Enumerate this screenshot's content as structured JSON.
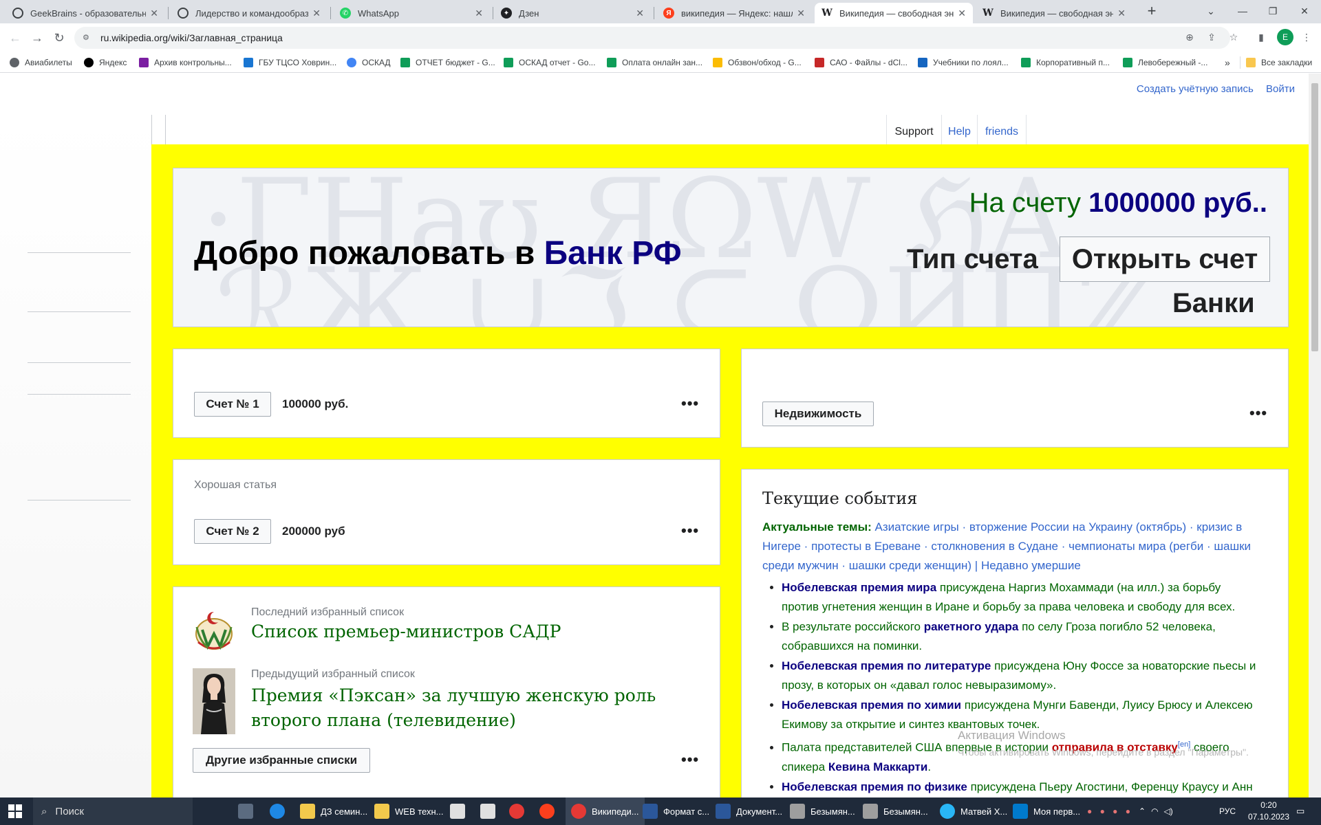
{
  "browser": {
    "tabs": [
      {
        "label": "GeekBrains - образовательный",
        "icon_color": "#3c4043"
      },
      {
        "label": "Лидерство и командообразов",
        "icon_color": "#3c4043"
      },
      {
        "label": "WhatsApp",
        "icon_color": "#25d366"
      },
      {
        "label": "Дзен",
        "icon_color": "#202124"
      },
      {
        "label": "википедия — Яндекс: нашлос",
        "icon_color": "#fc3f1d"
      },
      {
        "label": "Википедия — свободная энц",
        "icon_color": "#202124"
      },
      {
        "label": "Википедия — свободная энц",
        "icon_color": "#202124"
      }
    ],
    "new_tab": "+",
    "url": "ru.wikipedia.org/wiki/Заглавная_страница",
    "profile_initial": "E",
    "bookmarks": [
      {
        "label": "Авиабилеты",
        "color": "#5f6368"
      },
      {
        "label": "Яндекс",
        "color": "#000000"
      },
      {
        "label": "Архив контрольны...",
        "color": "#7b1fa2"
      },
      {
        "label": "ГБУ ТЦСО Ховрин...",
        "color": "#1976d2"
      },
      {
        "label": "ОСКАД",
        "color": "#4285f4"
      },
      {
        "label": "ОТЧЕТ бюджет - G...",
        "color": "#0f9d58"
      },
      {
        "label": "ОСКАД отчет - Go...",
        "color": "#0f9d58"
      },
      {
        "label": "Оплата онлайн зан...",
        "color": "#0f9d58"
      },
      {
        "label": "Обзвон/обход - G...",
        "color": "#fbbc04"
      },
      {
        "label": "САО - Файлы - dCl...",
        "color": "#c62828"
      },
      {
        "label": "Учебники по лоял...",
        "color": "#1565c0"
      },
      {
        "label": "Корпоративный п...",
        "color": "#0f9d58"
      },
      {
        "label": "Левобережный -...",
        "color": "#0f9d58"
      }
    ],
    "bookmarks_more": "»",
    "all_bookmarks": "Все закладки"
  },
  "page": {
    "user_links": [
      "Создать учётную запись",
      "Войти"
    ],
    "tabs": [
      "Support",
      "Help",
      "friends"
    ],
    "hero": {
      "welcome": "Добро пожаловать в ",
      "welcome_accent": "Банк РФ",
      "balance_label": "На счету ",
      "balance_value": "1000000 руб..",
      "account_type": "Тип счета",
      "open_account": "Открыть счет",
      "banks": "Банки",
      "bg_text_top": "·ΓΗaʊ ЯΩW ℌA",
      "bg_text_bottom": "ℛЖ ∪ℑ ⊆ ΩИΠℤ"
    },
    "account1": {
      "button": "Счет № 1",
      "amount": "100000 руб.",
      "menu": "•••"
    },
    "realty": {
      "button": "Недвижимость",
      "menu": "•••"
    },
    "account2": {
      "label": "Хорошая статья",
      "button": "Счет № 2",
      "amount": "200000 руб",
      "menu": "•••"
    },
    "featured": {
      "last_label": "Последний избранный список",
      "last_title": "Список премьер-министров САДР",
      "prev_label": "Предыдущий избранный список",
      "prev_title": "Премия «Пэксан» за лучшую женскую роль второго плана (телевидение)",
      "more_button": "Другие избранные списки",
      "menu": "•••"
    },
    "news": {
      "heading": "Текущие события",
      "topics_label": "Актуальные темы:",
      "topics": "Азиатские игры · вторжение России на Украину (октябрь) · кризис в Нигере · протесты в Ереване · столкновения в Судане · чемпионаты мира (регби · шашки среди мужчин · шашки среди женщин) | Недавно умершие",
      "items": [
        {
          "lead": "Нобелевская премия мира",
          "rest": " присуждена Наргиз Мохаммади (на илл.) за борьбу против угнетения женщин в Иране и борьбу за права человека и свободу для всех."
        },
        {
          "pre": "В результате российского ",
          "lead": "ракетного удара",
          "rest": " по селу Гроза погибло 52 человека, собравшихся на поминки."
        },
        {
          "lead": "Нобелевская премия по литературе",
          "rest": " присуждена Юну Фоссе за новаторские пьесы и прозу, в которых он «давал голос невыразимому»."
        },
        {
          "lead": "Нобелевская премия по химии",
          "rest": " присуждена Мунги Бавенди, Луису Брюсу и Алексею Екимову за открытие и синтез квантовых точек."
        },
        {
          "pre": "Палата представителей США впервые в истории ",
          "red": "отправила в отставку",
          "sup": "[en]",
          "rest": " своего спикера ",
          "lead2": "Кевина Маккарти",
          "end": "."
        },
        {
          "lead": "Нобелевская премия по физике",
          "rest": " присуждена Пьеру Агостини, Ференцу Краусу и Анн"
        }
      ]
    },
    "activation_title": "Активация Windows",
    "activation_text": "Чтобы активировать Windows, перейдите в раздел \"Параметры\"."
  },
  "taskbar": {
    "search": "Поиск",
    "apps": [
      {
        "label": "ДЗ семин...",
        "color": "#f2c94c"
      },
      {
        "label": "WEB техн...",
        "color": "#f2c94c"
      },
      {
        "label": "Википеди...",
        "color": "#e53935"
      },
      {
        "label": "Формат с...",
        "color": "#2b579a"
      },
      {
        "label": "Документ...",
        "color": "#2b579a"
      },
      {
        "label": "Безымян...",
        "color": "#9e9e9e"
      },
      {
        "label": "Безымян...",
        "color": "#9e9e9e"
      },
      {
        "label": "Матвей Х...",
        "color": "#29b6f6"
      },
      {
        "label": "Моя перв...",
        "color": "#007acc"
      }
    ],
    "lang": "РУС",
    "time": "0:20",
    "date": "07.10.2023"
  }
}
